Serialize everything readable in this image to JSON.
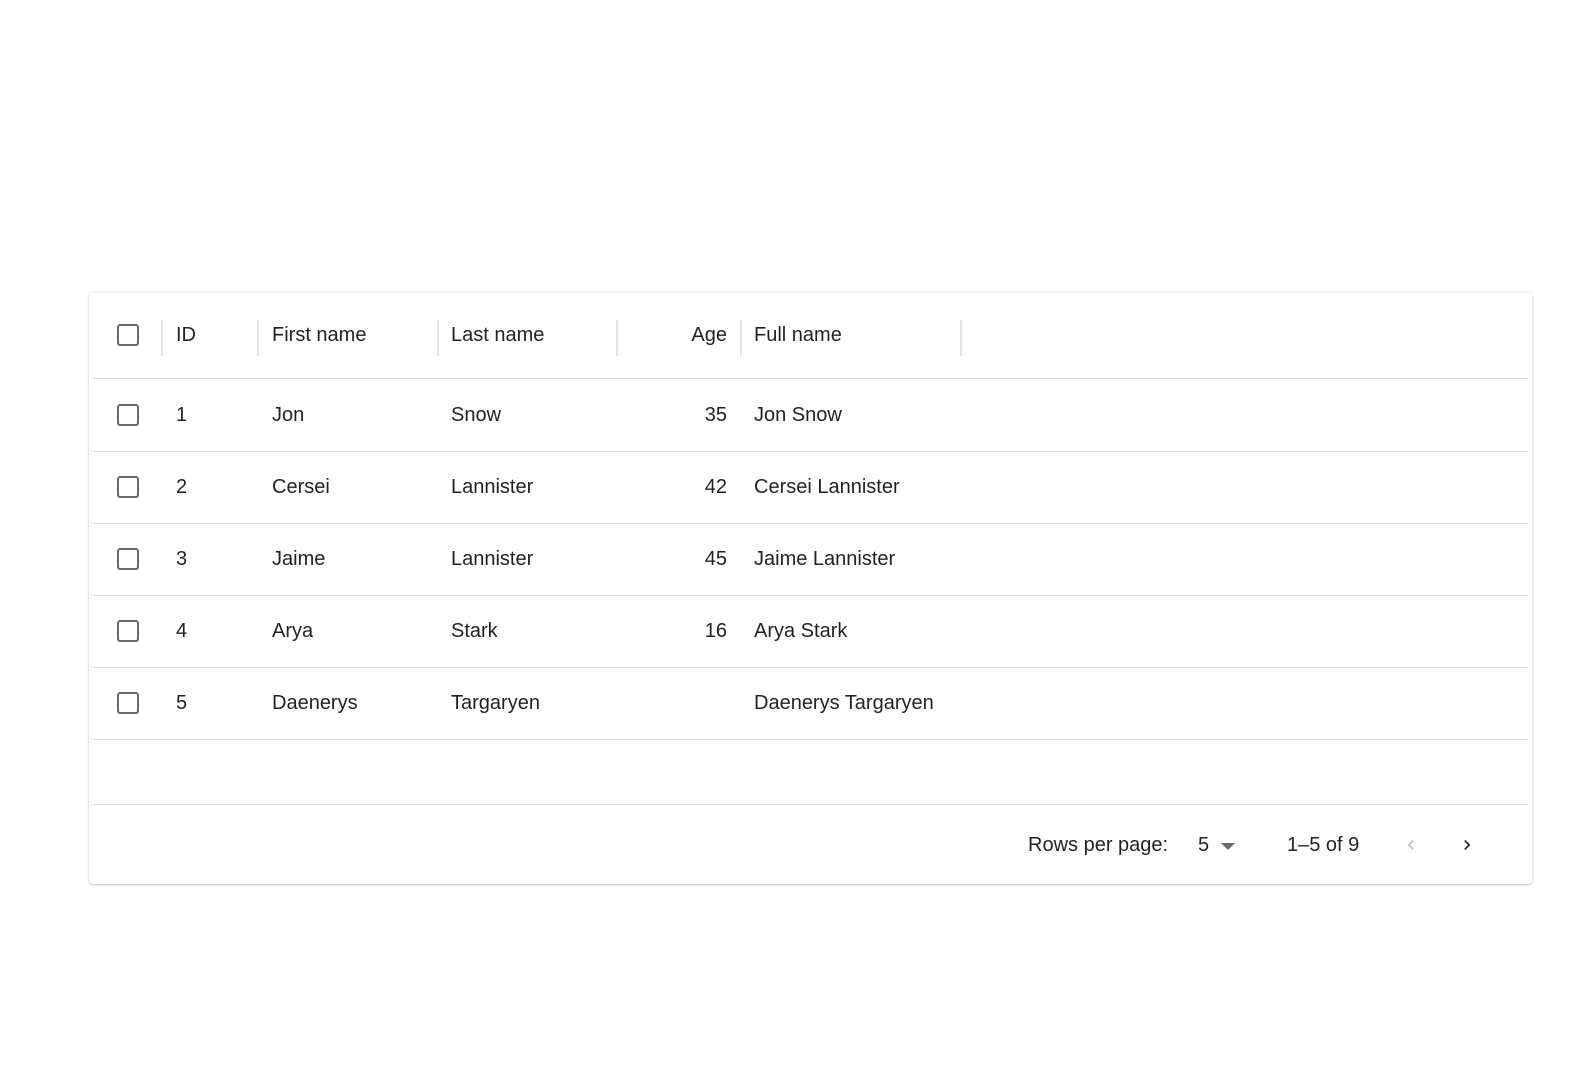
{
  "table": {
    "columns": [
      {
        "key": "select",
        "label": ""
      },
      {
        "key": "id",
        "label": "ID"
      },
      {
        "key": "first_name",
        "label": "First name"
      },
      {
        "key": "last_name",
        "label": "Last name"
      },
      {
        "key": "age",
        "label": "Age"
      },
      {
        "key": "full_name",
        "label": "Full name"
      }
    ],
    "rows": [
      {
        "id": "1",
        "first_name": "Jon",
        "last_name": "Snow",
        "age": "35",
        "full_name": "Jon Snow"
      },
      {
        "id": "2",
        "first_name": "Cersei",
        "last_name": "Lannister",
        "age": "42",
        "full_name": "Cersei Lannister"
      },
      {
        "id": "3",
        "first_name": "Jaime",
        "last_name": "Lannister",
        "age": "45",
        "full_name": "Jaime Lannister"
      },
      {
        "id": "4",
        "first_name": "Arya",
        "last_name": "Stark",
        "age": "16",
        "full_name": "Arya Stark"
      },
      {
        "id": "5",
        "first_name": "Daenerys",
        "last_name": "Targaryen",
        "age": "",
        "full_name": "Daenerys Targaryen"
      }
    ]
  },
  "pagination": {
    "rows_per_page_label": "Rows per page:",
    "rows_per_page_value": "5",
    "range_label": "1–5 of 9"
  },
  "icons": {
    "dropdown": "caret-down-icon",
    "prev": "chevron-left-icon",
    "next": "chevron-right-icon"
  },
  "colors": {
    "text": "#212121",
    "divider": "#e0e0e0",
    "checkbox_border": "#6b6b6b",
    "disabled_icon": "#bdbdbd"
  }
}
